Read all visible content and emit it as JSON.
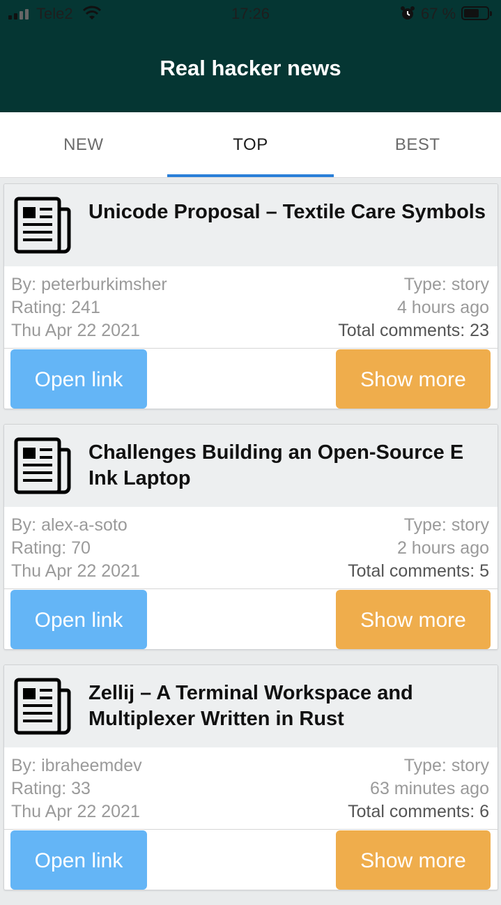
{
  "status_bar": {
    "carrier": "Tele2",
    "time": "17:26",
    "battery_percent": "67 %",
    "battery_level": 0.67,
    "icons": [
      "signal-icon",
      "wifi-icon",
      "alarm-icon",
      "battery-icon"
    ]
  },
  "app": {
    "title": "Real hacker news",
    "header_color": "#053633"
  },
  "tabs": [
    {
      "label": "NEW",
      "active": false
    },
    {
      "label": "TOP",
      "active": true
    },
    {
      "label": "BEST",
      "active": false
    }
  ],
  "colors": {
    "accent": "#2a7fd8",
    "open_button": "#64b5f6",
    "more_button": "#efad4c"
  },
  "stories": [
    {
      "title": "Unicode Proposal – Textile Care Symbols",
      "by": "By: peterburkimsher",
      "rating": "Rating: 241",
      "date": "Thu Apr 22 2021",
      "type": "Type: story",
      "ago": "4 hours ago",
      "comments": "Total comments: 23",
      "open_label": "Open link",
      "more_label": "Show more",
      "icon": "newspaper-icon"
    },
    {
      "title": "Challenges Building an Open-Source E Ink Laptop",
      "by": "By: alex-a-soto",
      "rating": "Rating: 70",
      "date": "Thu Apr 22 2021",
      "type": "Type: story",
      "ago": "2 hours ago",
      "comments": "Total comments: 5",
      "open_label": "Open link",
      "more_label": "Show more",
      "icon": "newspaper-icon"
    },
    {
      "title": "Zellij – A Terminal Workspace and Multiplexer Written in Rust",
      "by": "By: ibraheemdev",
      "rating": "Rating: 33",
      "date": "Thu Apr 22 2021",
      "type": "Type: story",
      "ago": "63 minutes ago",
      "comments": "Total comments: 6",
      "open_label": "Open link",
      "more_label": "Show more",
      "icon": "newspaper-icon"
    }
  ]
}
